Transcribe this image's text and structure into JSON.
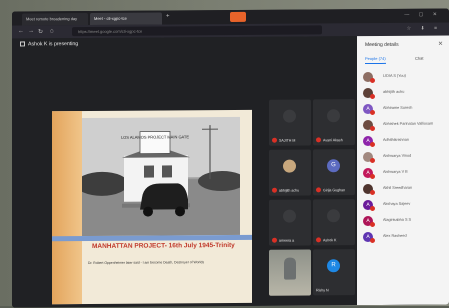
{
  "browser": {
    "tabs": [
      {
        "label": "Meet remote broadening day"
      },
      {
        "label": "Meet - cti-xgpc-tce"
      }
    ],
    "new_tab": "+",
    "url": "https://meet.google.com/cti-xgpc-tce"
  },
  "meet": {
    "presenting_text": "Ashok K is presenting",
    "slide": {
      "title": "MANHATTAN PROJECT- 16th July 1945-Trinity",
      "subtitle": "Dr. Robert Oppenheimer later said - I am become Death, Destroyer of Worlds",
      "sign_text": "LOS ALAMOS PROJECT MAIN GATE"
    },
    "tiles": [
      {
        "name": "SAJITH M",
        "letter": "",
        "color": ""
      },
      {
        "name": "Avani Akash",
        "letter": "",
        "color": ""
      },
      {
        "name": "abhijith achu",
        "letter": "",
        "color": ""
      },
      {
        "name": "Girija Gughan",
        "letter": "G",
        "color": "#5c6bc0"
      },
      {
        "name": "ameera a",
        "letter": "",
        "color": ""
      },
      {
        "name": "Ashok K",
        "letter": "",
        "color": ""
      },
      {
        "name": "",
        "letter": "",
        "color": ""
      },
      {
        "name": "Rishy N",
        "letter": "R",
        "color": "#1e88e5"
      }
    ]
  },
  "panel": {
    "title": "Meeting details",
    "close_icon": "close-icon",
    "tab_people": "People (74)",
    "tab_chat": "Chat",
    "participants": [
      {
        "name": "LIDIA S (You)",
        "letter": "",
        "color": "#8d6e63"
      },
      {
        "name": "abhijith achu",
        "letter": "",
        "color": "#5d4037"
      },
      {
        "name": "Abhirame Suresh",
        "letter": "A",
        "color": "#7e57c2"
      },
      {
        "name": "Abhishek Parinatan Valliosam",
        "letter": "",
        "color": "#6d4c41"
      },
      {
        "name": "Adhithikrishnan",
        "letter": "A",
        "color": "#8e24aa"
      },
      {
        "name": "Aishwarya Vinod",
        "letter": "",
        "color": "#a1887f"
      },
      {
        "name": "Aishwarya V B",
        "letter": "A",
        "color": "#c2185b"
      },
      {
        "name": "Akhil Sreedharan",
        "letter": "",
        "color": "#4e342e"
      },
      {
        "name": "Akshaya Sajeev",
        "letter": "A",
        "color": "#6a1b9a"
      },
      {
        "name": "Alagirisabha S S",
        "letter": "A",
        "color": "#ad1457"
      },
      {
        "name": "Alex Rasheed",
        "letter": "A",
        "color": "#5e35b1"
      }
    ]
  }
}
